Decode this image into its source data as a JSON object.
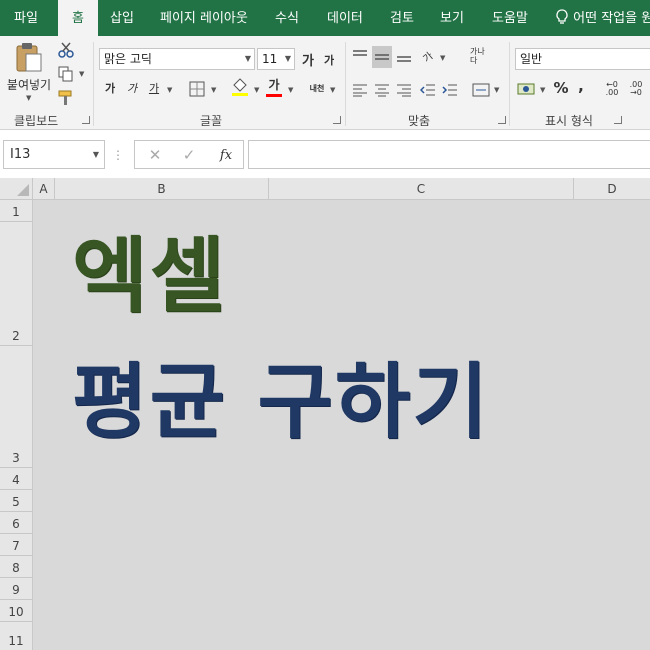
{
  "ribbon_tabs": {
    "file": "파일",
    "home": "홈",
    "insert": "삽입",
    "page_layout": "페이지 레이아웃",
    "formulas": "수식",
    "data": "데이터",
    "review": "검토",
    "view": "보기",
    "help": "도움말",
    "tell_me": "어떤 작업을 원"
  },
  "clipboard": {
    "paste_label": "붙여넣기",
    "group_label": "클립보드"
  },
  "font": {
    "font_name": "맑은 고딕",
    "font_size": "11",
    "grow_label": "가",
    "shrink_label": "가",
    "bold_label": "가",
    "italic_label": "가",
    "underline_label": "가",
    "font_color_label": "가",
    "phonetic_label": "내천",
    "group_label": "글꼴"
  },
  "alignment": {
    "orientation_label": "가",
    "wrap_label": "가나다",
    "group_label": "맞춤"
  },
  "number": {
    "format": "일반",
    "percent": "%",
    "comma": ",",
    "increase_decimal": "←0 .00",
    "decrease_decimal": ".00 →0",
    "group_label": "표시 형식"
  },
  "formula_bar": {
    "name_box": "I13",
    "formula": ""
  },
  "columns": [
    "A",
    "B",
    "C",
    "D"
  ],
  "rows": [
    "1",
    "2",
    "3",
    "4",
    "5",
    "6",
    "7",
    "8",
    "9",
    "10",
    "11"
  ],
  "content": {
    "title_line1": "엑셀",
    "title_line2": "평균 구하기"
  },
  "colors": {
    "excel_green": "#217346",
    "title1_color": "#375623",
    "title2_color": "#1f3864",
    "sheet_fill": "#d9d9d9"
  }
}
